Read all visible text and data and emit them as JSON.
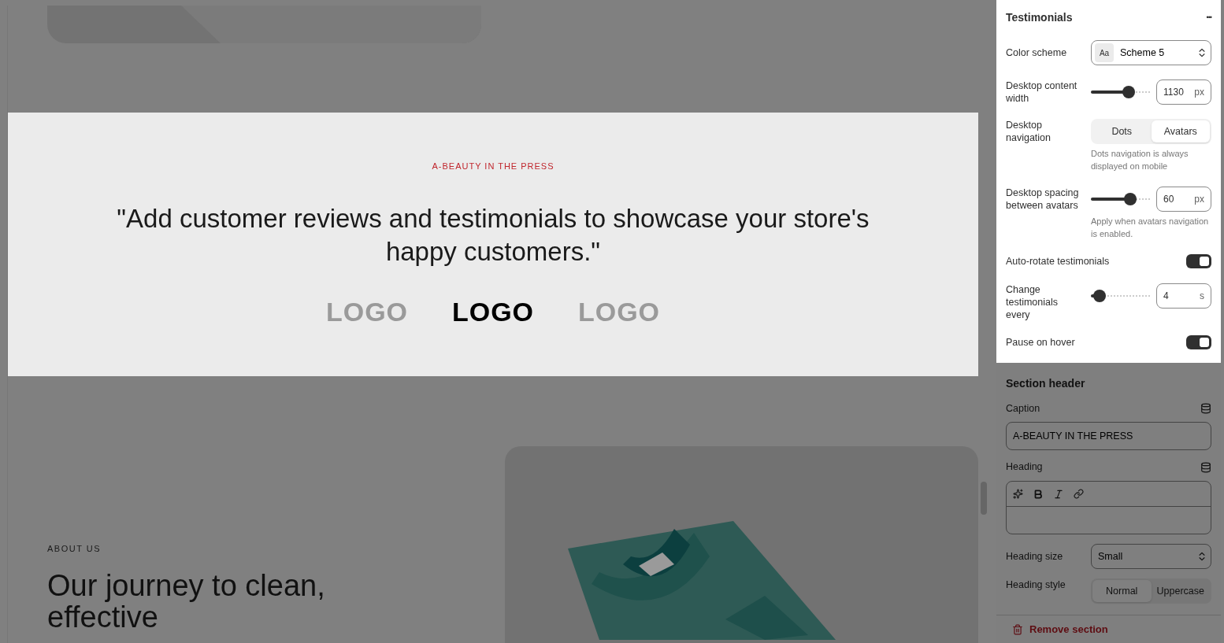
{
  "preview": {
    "testimonials": {
      "caption": "A-BEAUTY IN THE PRESS",
      "quote": "\"Add customer reviews and testimonials to showcase your store's happy customers.\"",
      "logos": [
        {
          "text": "LOGO",
          "selected": false
        },
        {
          "text": "LOGO",
          "selected": true
        },
        {
          "text": "LOGO",
          "selected": false
        }
      ]
    },
    "about": {
      "caption": "ABOUT US",
      "heading": "Our journey to clean, effective"
    }
  },
  "panel": {
    "title": "Testimonials",
    "menu": "•••",
    "settings": [
      {
        "kind": "select",
        "label": "Color scheme",
        "value": "Scheme 5",
        "swatch": "Aa"
      },
      {
        "kind": "slider",
        "label": "Desktop content width",
        "level": 0.64,
        "value": "1130",
        "unit": "px"
      },
      {
        "kind": "segmented",
        "label": "Desktop navigation",
        "options": [
          {
            "label": "Dots",
            "selected": false
          },
          {
            "label": "Avatars",
            "selected": true
          }
        ],
        "help": "Dots navigation is always displayed on mobile"
      },
      {
        "kind": "slider",
        "label": "Desktop spacing between avatars",
        "level": 0.66,
        "value": "60",
        "unit": "px",
        "help": "Apply when avatars navigation is enabled."
      },
      {
        "kind": "toggle",
        "label": "Auto-rotate testimonials",
        "on": true
      },
      {
        "kind": "slider",
        "label": "Change testimonials every",
        "level": 0.14,
        "value": "4",
        "unit": "s"
      },
      {
        "kind": "toggle",
        "label": "Pause on hover",
        "on": true
      }
    ],
    "section_header": {
      "title": "Section header",
      "settings": [
        {
          "kind": "text",
          "label": "Caption",
          "value": "A-BEAUTY IN THE PRESS"
        },
        {
          "kind": "richtext",
          "label": "Heading"
        },
        {
          "kind": "select",
          "label": "Heading size",
          "value": "Small"
        },
        {
          "kind": "segmented",
          "label": "Heading style",
          "options": [
            {
              "label": "Normal",
              "selected": true
            },
            {
              "label": "Uppercase",
              "selected": false
            }
          ]
        }
      ]
    },
    "remove": "Remove section"
  }
}
